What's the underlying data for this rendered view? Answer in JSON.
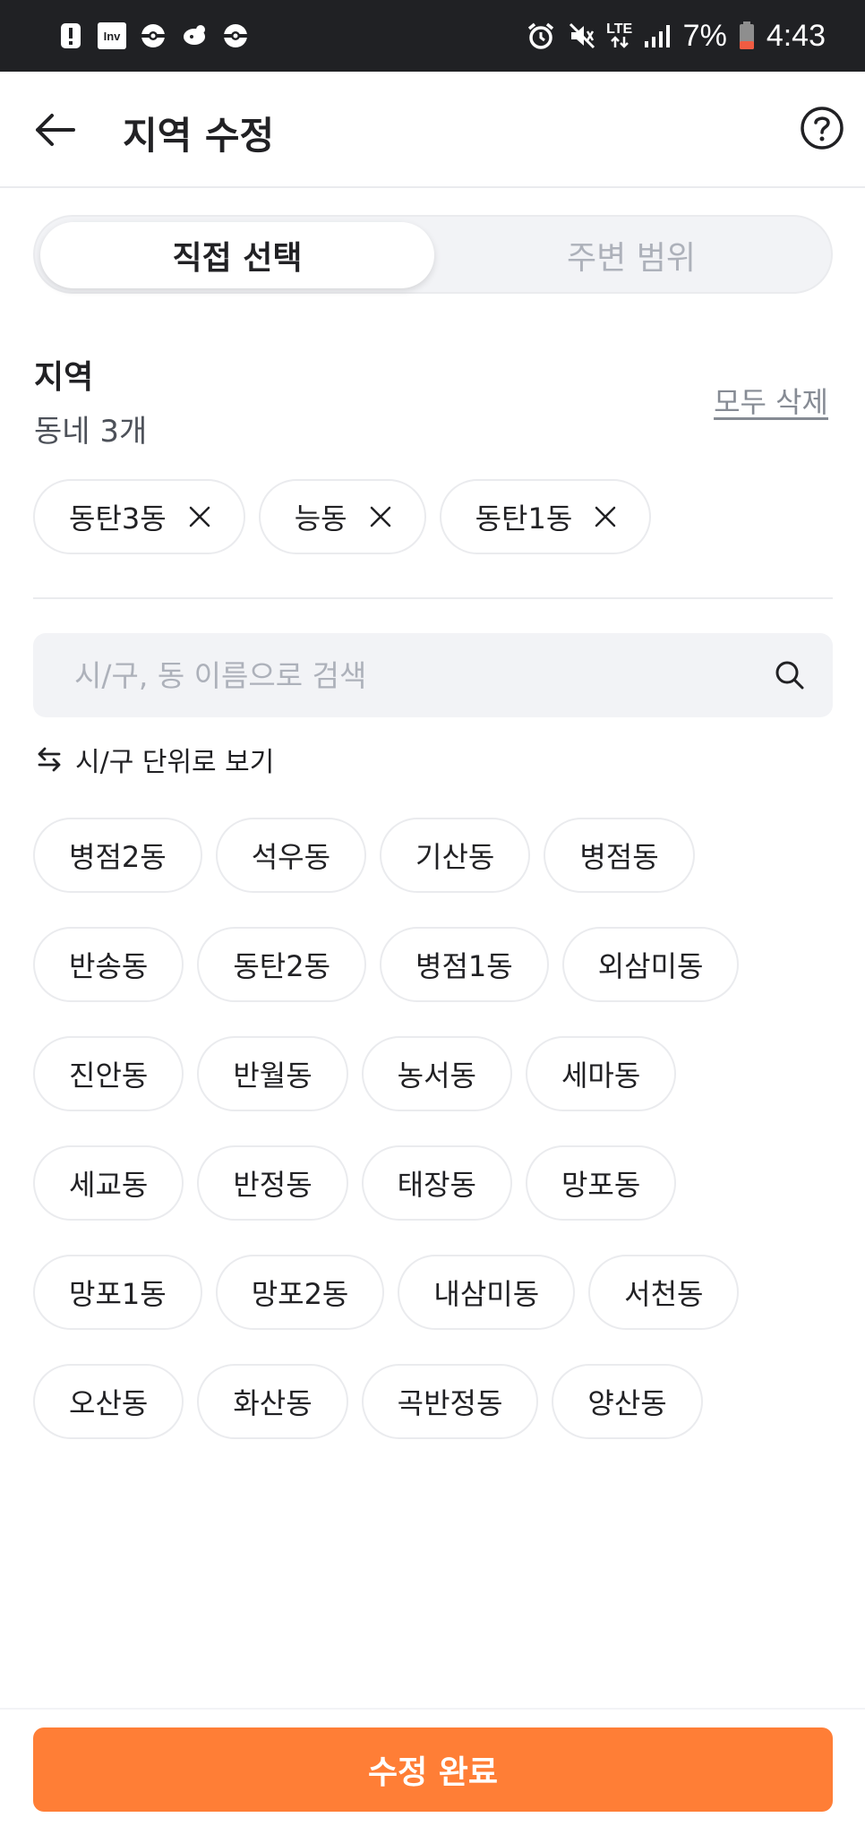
{
  "status_bar": {
    "left_icons": [
      "alert-icon",
      "inv-app-icon",
      "pokeball-icon",
      "chat-bird-icon",
      "pokeball-icon"
    ],
    "inv_label": "Inv",
    "lte_label": "LTE",
    "battery_percent": "7%",
    "time": "4:43"
  },
  "header": {
    "title": "지역 수정",
    "back_icon": "arrow-left-icon",
    "help_icon": "question-circle-icon"
  },
  "tabs": {
    "active": "직접 선택",
    "inactive": "주변 범위"
  },
  "region": {
    "title": "지역",
    "count_label": "동네 3개",
    "delete_all": "모두 삭제",
    "selected": [
      "동탄3동",
      "능동",
      "동탄1동"
    ]
  },
  "search": {
    "placeholder": "시/구, 동 이름으로 검색"
  },
  "view_toggle": {
    "label": "시/구 단위로 보기"
  },
  "options": [
    [
      "병점2동",
      "석우동",
      "기산동",
      "병점동"
    ],
    [
      "반송동",
      "동탄2동",
      "병점1동",
      "외삼미동"
    ],
    [
      "진안동",
      "반월동",
      "농서동",
      "세마동"
    ],
    [
      "세교동",
      "반정동",
      "태장동",
      "망포동"
    ],
    [
      "망포1동",
      "망포2동",
      "내삼미동",
      "서천동"
    ],
    [
      "오산동",
      "화산동",
      "곡반정동",
      "양산동"
    ]
  ],
  "submit": {
    "label": "수정 완료"
  },
  "colors": {
    "accent": "#ff7e36",
    "status_bar": "#202124",
    "battery_low": "#f05c42"
  }
}
